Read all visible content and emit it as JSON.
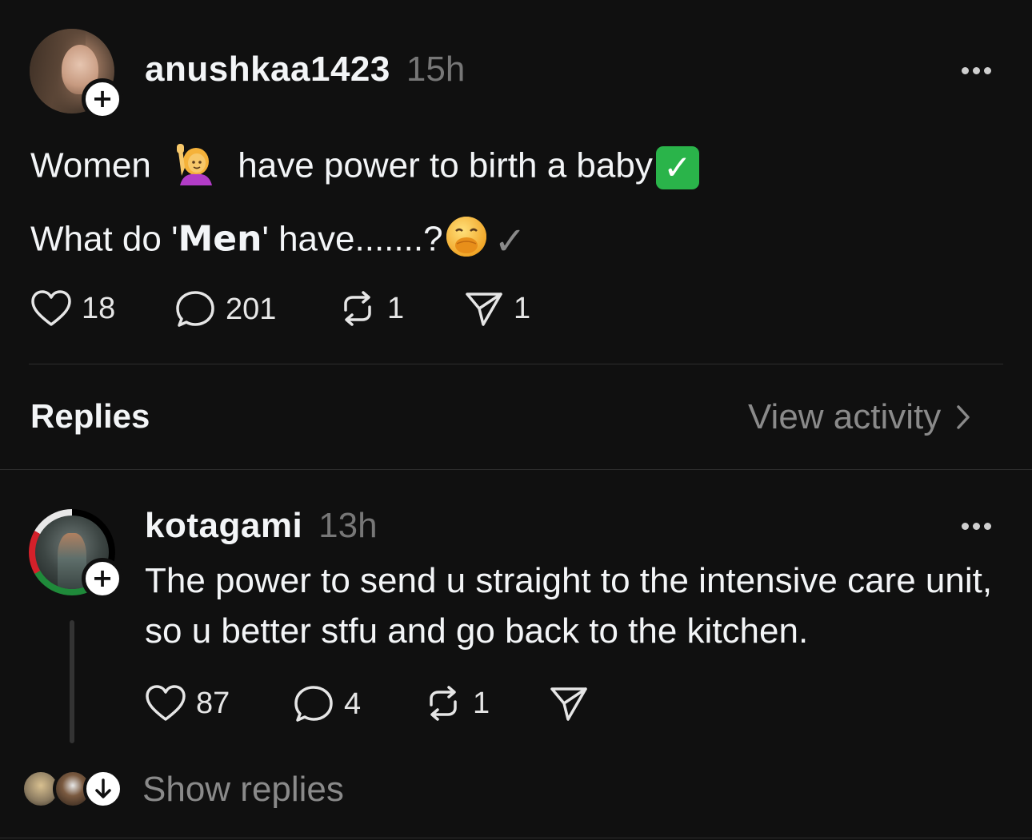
{
  "post": {
    "username": "anushkaa1423",
    "time": "15h",
    "line1_start": "Women",
    "line1_emoji": "woman-raising-hand-emoji",
    "line1_end": "have power to birth a baby",
    "line1_check": "✓",
    "line2_start": "What do '",
    "line2_bold": "Men",
    "line2_end": "' have.......?",
    "line2_emoji": "face-with-hand-over-mouth-emoji",
    "line2_check": "✓",
    "stats": {
      "likes": "18",
      "comments": "201",
      "reposts": "1",
      "shares": "1"
    }
  },
  "replies_header": {
    "title": "Replies",
    "view_activity": "View activity"
  },
  "reply": {
    "username": "kotagami",
    "time": "13h",
    "text": "The power to send u straight to the intensive care unit, so u better stfu and go back to the kitchen.",
    "stats": {
      "likes": "87",
      "comments": "4",
      "reposts": "1"
    }
  },
  "show_replies": "Show replies",
  "colors": {
    "background": "#101010",
    "text": "#f3f5f7",
    "muted": "#777777",
    "check_green": "#2ab44a"
  }
}
